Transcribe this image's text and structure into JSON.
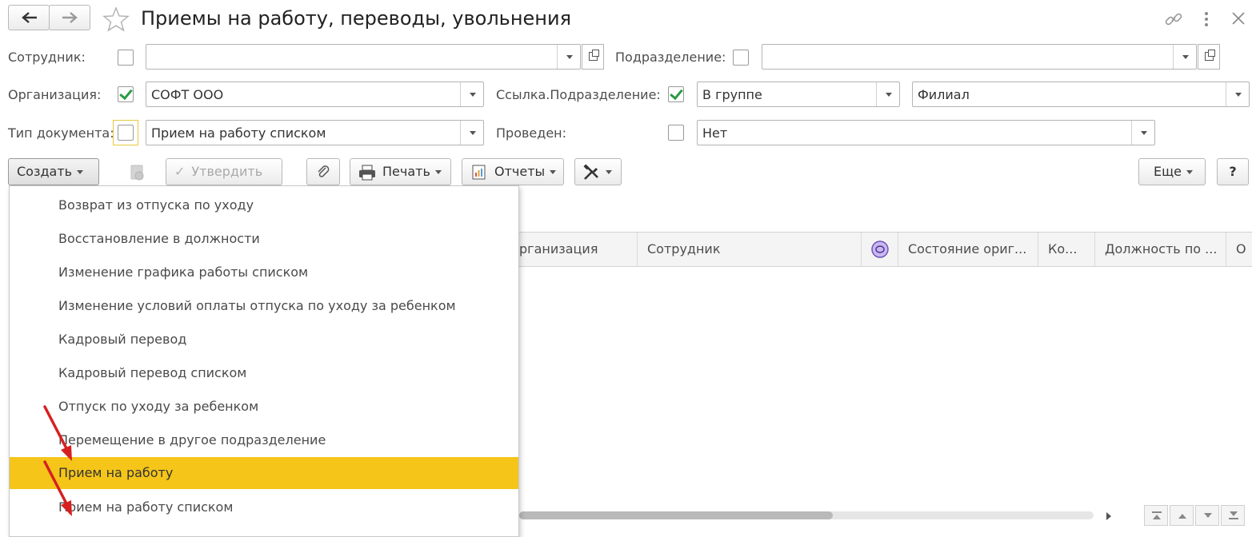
{
  "header": {
    "title": "Приемы на работу, переводы, увольнения"
  },
  "filters": {
    "employee_label": "Сотрудник:",
    "employee_value": "",
    "department_label": "Подразделение:",
    "department_value": "",
    "organization_label": "Организация:",
    "organization_value": "СОФТ ООО",
    "dept_ref_label": "Ссылка.Подразделение:",
    "dept_ref_mode": "В группе",
    "dept_ref_value": "Филиал",
    "doc_type_label": "Тип документа:",
    "doc_type_value": "Прием на работу списком",
    "posted_label": "Проведен:",
    "posted_value": "Нет"
  },
  "toolbar": {
    "create_label": "Создать",
    "approve_label": "Утвердить",
    "print_label": "Печать",
    "reports_label": "Отчеты",
    "more_label": "Еще",
    "help_label": "?"
  },
  "menu": {
    "items": [
      {
        "label": "Возврат из отпуска по уходу"
      },
      {
        "label": "Восстановление в должности"
      },
      {
        "label": "Изменение графика работы списком"
      },
      {
        "label": "Изменение условий оплаты отпуска по уходу за ребенком"
      },
      {
        "label": "Кадровый перевод"
      },
      {
        "label": "Кадровый перевод списком"
      },
      {
        "label": "Отпуск по уходу за ребенком"
      },
      {
        "label": "Перемещение в другое подразделение"
      },
      {
        "label": "Прием на работу"
      },
      {
        "label": "Прием на работу списком"
      }
    ],
    "highlight_color": "#f5c519"
  },
  "grid": {
    "columns": [
      "рганизация",
      "Сотрудник",
      "Состояние ориг...",
      "Ко...",
      "Должность по ...",
      "О"
    ]
  }
}
